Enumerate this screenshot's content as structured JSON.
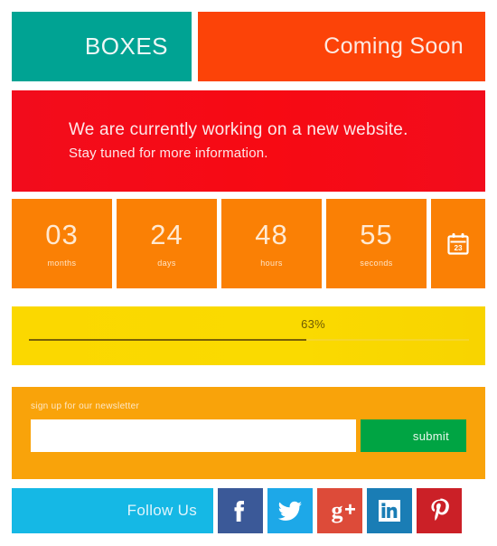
{
  "header": {
    "logo": "BOXES",
    "tagline": "Coming Soon",
    "logo_bg": "#00a393",
    "tagline_bg": "#fc4308"
  },
  "banner": {
    "line1": "We are currently working on a new website.",
    "line2": "Stay tuned for more information.",
    "bg": "#f20c1c"
  },
  "countdown": {
    "bg": "#fa8005",
    "items": [
      {
        "value": "03",
        "label": "months"
      },
      {
        "value": "24",
        "label": "days"
      },
      {
        "value": "48",
        "label": "hours"
      },
      {
        "value": "55",
        "label": "seconds"
      }
    ],
    "calendar": {
      "icon": "calendar-icon",
      "day": "23"
    }
  },
  "progress": {
    "percent_label": "63%",
    "percent_value": 63,
    "bg": "#fbd800",
    "fill_color": "#7a6206"
  },
  "newsletter": {
    "label": "sign up for our newsletter",
    "input_value": "",
    "input_placeholder": "",
    "submit_label": "submit",
    "bg": "#f9a30a",
    "submit_bg": "#00a443"
  },
  "footer": {
    "follow_label": "Follow Us",
    "follow_bg": "#15b8e5",
    "socials": [
      {
        "name": "facebook-icon",
        "label": "f",
        "color": "#3b5998"
      },
      {
        "name": "twitter-icon",
        "label": "twitter",
        "color": "#1da8e8"
      },
      {
        "name": "google-plus-icon",
        "label": "g+",
        "color": "#dd4b39"
      },
      {
        "name": "linkedin-icon",
        "label": "in",
        "color": "#1a7db5"
      },
      {
        "name": "pinterest-icon",
        "label": "p",
        "color": "#cb2027"
      }
    ]
  }
}
